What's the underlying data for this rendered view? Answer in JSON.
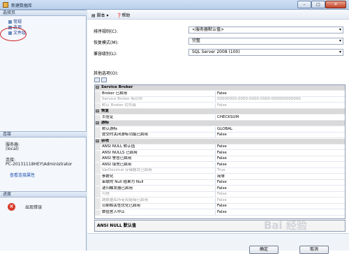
{
  "window": {
    "title": "新建数据库"
  },
  "left": {
    "select_page_header": "选择页",
    "pages": [
      "常规",
      "选项",
      "文件组"
    ],
    "connection_header": "连接",
    "server_label": "服务器:",
    "server_value": "(local)",
    "connection_label": "连接:",
    "connection_value": "PC-20131118HEY\\Administrator",
    "view_conn_props": "查看连接属性",
    "progress_header": "进度",
    "progress_status": "出现错误"
  },
  "toolbar": {
    "script": "脚本",
    "help": "帮助"
  },
  "form": {
    "collation_label": "排序规则(C):",
    "collation_value": "<服务器默认值>",
    "recovery_label": "恢复模式(M):",
    "recovery_value": "完整",
    "compat_label": "兼容级别(L):",
    "compat_value": "SQL Server 2008 (100)",
    "other_options_label": "其他选项(O):"
  },
  "grid": [
    {
      "type": "cat",
      "key": "Service Broker"
    },
    {
      "type": "row",
      "key": "Broker 已启用",
      "value": "False"
    },
    {
      "type": "dis",
      "key": "Service Broker 标识符",
      "value": "00000000-0000-0000-0000-000000000000"
    },
    {
      "type": "dis",
      "key": "默认 Broker 优先级",
      "value": "False"
    },
    {
      "type": "cat",
      "key": "恢复"
    },
    {
      "type": "row",
      "key": "页验证",
      "value": "CHECKSUM"
    },
    {
      "type": "cat",
      "key": "游标"
    },
    {
      "type": "row",
      "key": "默认游标",
      "value": "GLOBAL"
    },
    {
      "type": "row",
      "key": "提交时关闭游标功能已启用",
      "value": "False"
    },
    {
      "type": "cat",
      "key": "杂项"
    },
    {
      "type": "row",
      "key": "ANSI NULL 默认值",
      "value": "False"
    },
    {
      "type": "row",
      "key": "ANSI NULLS 已启用",
      "value": "False"
    },
    {
      "type": "row",
      "key": "ANSI 警告已启用",
      "value": "False"
    },
    {
      "type": "row",
      "key": "ANSI 填充已启用",
      "value": "False"
    },
    {
      "type": "dis",
      "key": "VarDecimal 存储格式已启用",
      "value": "True"
    },
    {
      "type": "row",
      "key": "参数化",
      "value": "简单"
    },
    {
      "type": "row",
      "key": "串联的 Null 结果为 Null",
      "value": "False"
    },
    {
      "type": "row",
      "key": "递归触发器已启用",
      "value": "False"
    },
    {
      "type": "dis",
      "key": "可信",
      "value": "False"
    },
    {
      "type": "dis",
      "key": "跨数据库所有权链接已启用",
      "value": "False"
    },
    {
      "type": "row",
      "key": "日期相关性优化已启用",
      "value": "False"
    },
    {
      "type": "row",
      "key": "数值舍入中止",
      "value": "False"
    }
  ],
  "description": "ANSI NULL 默认值",
  "buttons": {
    "ok": "确定",
    "cancel": "取消"
  },
  "watermark": "Bai 经验"
}
